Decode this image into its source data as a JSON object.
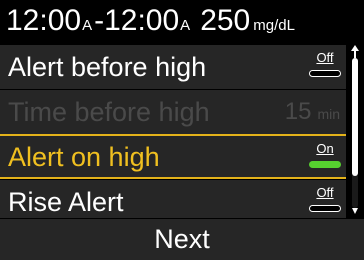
{
  "header": {
    "start_time": "12:00",
    "start_ampm": "A",
    "separator": "-",
    "end_time": "12:00",
    "end_ampm": "A",
    "glucose_value": "250",
    "glucose_unit": "mg/dL"
  },
  "settings": [
    {
      "label": "Alert before high",
      "control": "toggle",
      "state": "Off",
      "enabled": true,
      "selected": false
    },
    {
      "label": "Time before high",
      "control": "value",
      "value": "15",
      "unit": "min",
      "enabled": false,
      "selected": false
    },
    {
      "label": "Alert on high",
      "control": "toggle",
      "state": "On",
      "enabled": true,
      "selected": true
    },
    {
      "label": "Rise Alert",
      "control": "toggle",
      "state": "Off",
      "enabled": true,
      "selected": false
    }
  ],
  "footer": {
    "next_label": "Next"
  },
  "colors": {
    "background": "#000000",
    "row_background": "#262626",
    "selection_accent": "#e3b21a",
    "toggle_on": "#56d12f",
    "disabled_text": "#4a4a4a"
  },
  "icons": {
    "scroll_up": "scroll-up-arrow-icon",
    "scroll_down": "scroll-down-arrow-icon"
  }
}
